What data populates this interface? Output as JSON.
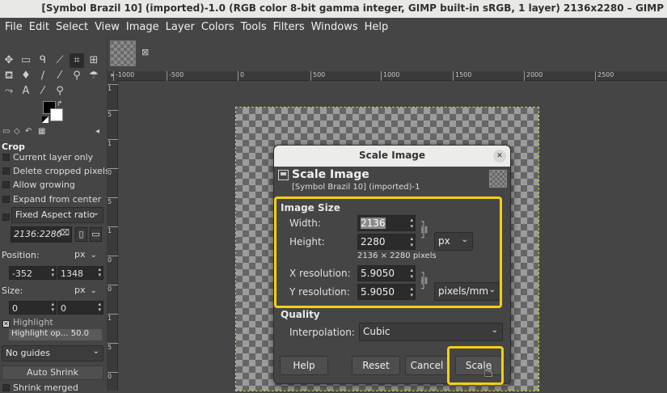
{
  "window": {
    "title": "[Symbol Brazil 10] (imported)-1.0 (RGB color 8-bit gamma integer, GIMP built-in sRGB, 1 layer) 2136x2280 – GIMP"
  },
  "menubar": [
    "File",
    "Edit",
    "Select",
    "View",
    "Image",
    "Layer",
    "Colors",
    "Tools",
    "Filters",
    "Windows",
    "Help"
  ],
  "toolbox": {
    "icons": [
      "move-icon",
      "rect-select-icon",
      "lasso-icon",
      "fuzzy-select-icon",
      "crop-icon",
      "transform-icon",
      "bucket-fill-icon",
      "paint-icon",
      "pencil-icon",
      "clone-icon",
      "smudge-icon",
      "path-icon",
      "text-icon",
      "color-picker-icon",
      "zoom-icon"
    ]
  },
  "tool_options": {
    "title": "Crop",
    "current_layer_only": "Current layer only",
    "delete_cropped": "Delete cropped pixels",
    "allow_growing": "Allow growing",
    "expand_from_center": "Expand from center",
    "fixed_aspect": "Fixed Aspect ratio",
    "aspect_value": "2136:2280",
    "position_label": "Position:",
    "position_unit": "px",
    "position_x": "-352",
    "position_y": "1348",
    "size_label": "Size:",
    "size_unit": "px",
    "size_w": "0",
    "size_h": "0",
    "highlight": "Highlight",
    "highlight_opacity_label": "Highlight op...",
    "highlight_opacity_value": "50.0",
    "guides": "No guides",
    "auto_shrink": "Auto Shrink",
    "shrink_merged": "Shrink merged"
  },
  "rulers": {
    "h_ticks": [
      "-1000",
      "-500",
      "0",
      "500",
      "1000",
      "1500",
      "2000",
      "2500"
    ],
    "v_ticks": [
      "1",
      "5",
      "1",
      "0",
      "5",
      "1",
      "0",
      "0",
      "1",
      "5",
      "0"
    ]
  },
  "dialog": {
    "window_title": "Scale Image",
    "heading": "Scale Image",
    "subtitle": "[Symbol Brazil 10] (imported)-1",
    "image_size_title": "Image Size",
    "width_label": "Width:",
    "width_value": "2136",
    "height_label": "Height:",
    "height_value": "2280",
    "size_unit": "px",
    "pixels_info": "2136 × 2280 pixels",
    "xres_label": "X resolution:",
    "xres_value": "5.9050",
    "yres_label": "Y resolution:",
    "yres_value": "5.9050",
    "res_unit": "pixels/mm",
    "quality_title": "Quality",
    "interp_label": "Interpolation:",
    "interp_value": "Cubic",
    "help_button": "Help",
    "reset_button": "Reset",
    "cancel_button": "Cancel",
    "scale_button": "Scale"
  },
  "colors": {
    "highlight": "#f4cf16",
    "selection_dash": "#d6d635"
  }
}
